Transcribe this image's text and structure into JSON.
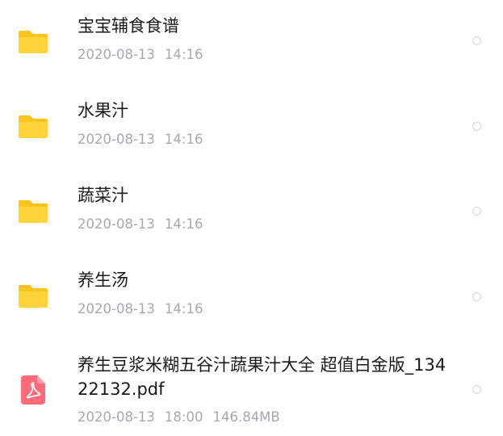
{
  "colors": {
    "folder": "#FFD43B",
    "folder_tab": "#FCC419",
    "pdf": "#FF6B7A",
    "name_text": "#1a1a1a",
    "meta_text": "#a7a8b4",
    "radio_border": "#d6d6da"
  },
  "files": [
    {
      "icon": "folder-icon",
      "name": "宝宝辅食食谱",
      "date": "2020-08-13",
      "time": "14:16",
      "size": ""
    },
    {
      "icon": "folder-icon",
      "name": "水果汁",
      "date": "2020-08-13",
      "time": "14:16",
      "size": ""
    },
    {
      "icon": "folder-icon",
      "name": "蔬菜汁",
      "date": "2020-08-13",
      "time": "14:16",
      "size": ""
    },
    {
      "icon": "folder-icon",
      "name": "养生汤",
      "date": "2020-08-13",
      "time": "14:16",
      "size": ""
    },
    {
      "icon": "pdf-file-icon",
      "name": "养生豆浆米糊五谷汁蔬果汁大全 超值白金版_13422132.pdf",
      "date": "2020-08-13",
      "time": "18:00",
      "size": "146.84MB"
    }
  ]
}
